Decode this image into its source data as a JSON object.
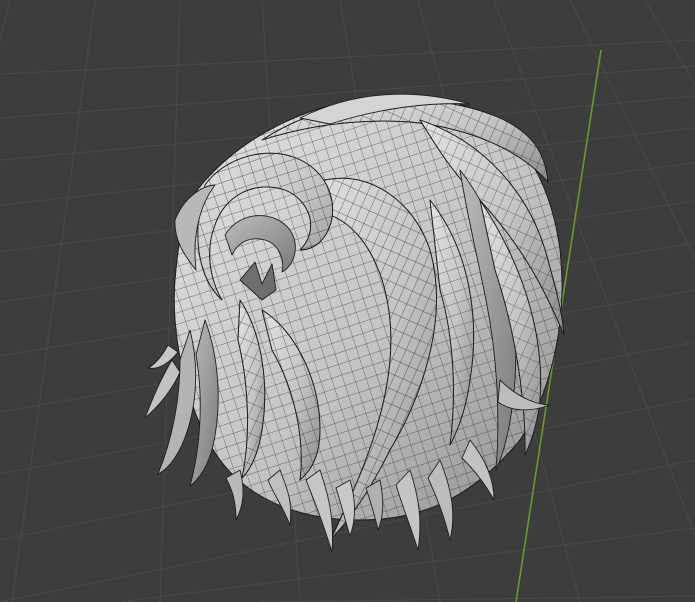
{
  "viewport": {
    "kind": "3d-viewport",
    "background_color": "#3d3d3d",
    "grid_line_color": "#4a4a4a",
    "grid_line_color_strong": "#525252",
    "y_axis_color": "#6b9a2a",
    "mesh": {
      "name": "hair-mesh",
      "display": "solid-with-wireframe",
      "shade_color": "#c9c9c9",
      "shade_dark": "#8f8f8f",
      "shade_light": "#dedede",
      "wire_color": "#1e1e1e"
    }
  }
}
